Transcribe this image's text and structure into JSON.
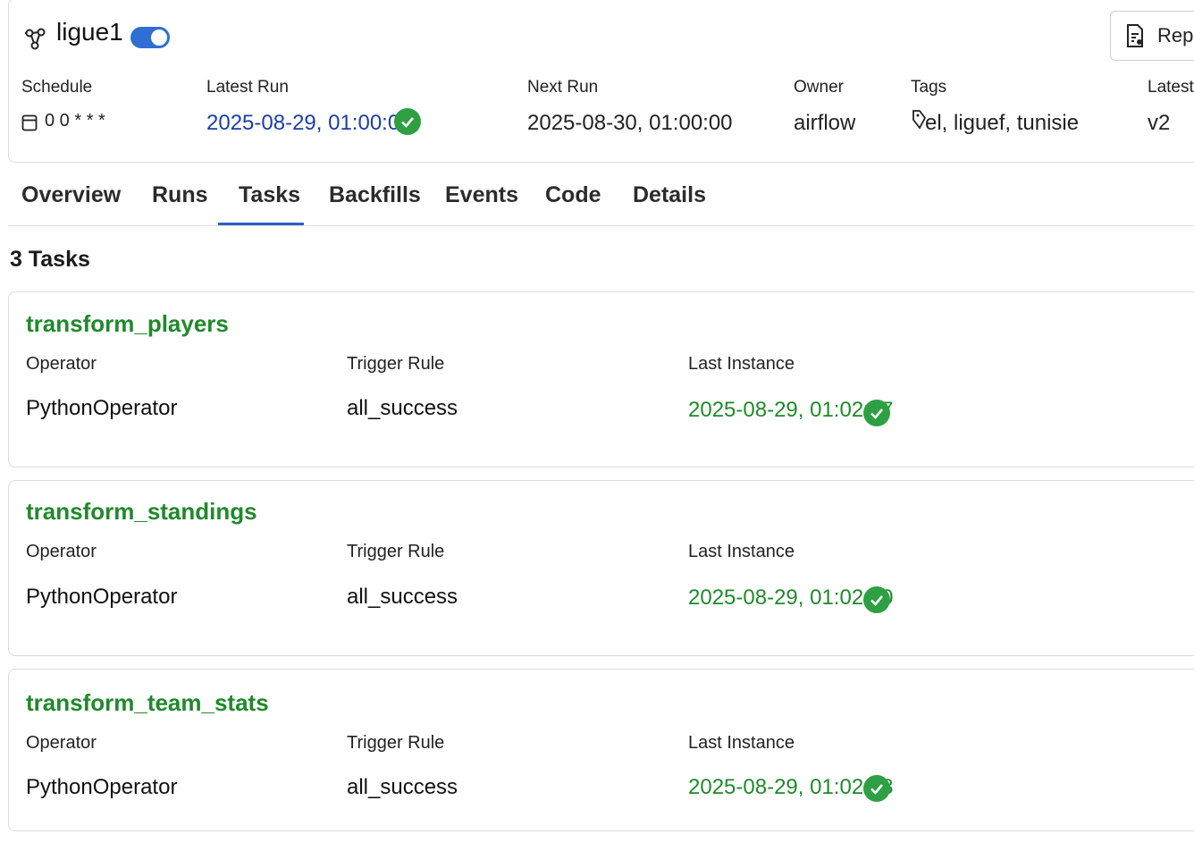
{
  "header": {
    "dag_id": "ligue1",
    "paused_toggle": "on",
    "reparse_label": "Repa",
    "schedule": {
      "label": "Schedule",
      "value": "0 0 * * *"
    },
    "latest_run": {
      "label": "Latest Run",
      "value": "2025-08-29, 01:00:00",
      "status": "success"
    },
    "next_run": {
      "label": "Next Run",
      "value": "2025-08-30, 01:00:00"
    },
    "owner": {
      "label": "Owner",
      "value": "airflow"
    },
    "tags": {
      "label": "Tags",
      "value": "el, liguef, tunisie"
    },
    "latest_version": {
      "label": "Latest",
      "value": "v2"
    }
  },
  "tabs": [
    {
      "label": "Overview"
    },
    {
      "label": "Runs"
    },
    {
      "label": "Tasks",
      "active": true
    },
    {
      "label": "Backfills"
    },
    {
      "label": "Events"
    },
    {
      "label": "Code"
    },
    {
      "label": "Details"
    }
  ],
  "task_count": "3 Tasks",
  "column_labels": {
    "operator": "Operator",
    "trigger_rule": "Trigger Rule",
    "last_instance": "Last Instance"
  },
  "tasks": [
    {
      "name": "transform_players",
      "operator": "PythonOperator",
      "trigger_rule": "all_success",
      "last_instance": "2025-08-29, 01:02:47",
      "status": "success"
    },
    {
      "name": "transform_standings",
      "operator": "PythonOperator",
      "trigger_rule": "all_success",
      "last_instance": "2025-08-29, 01:02:50",
      "status": "success"
    },
    {
      "name": "transform_team_stats",
      "operator": "PythonOperator",
      "trigger_rule": "all_success",
      "last_instance": "2025-08-29, 01:02:48",
      "status": "success"
    }
  ],
  "colors": {
    "success_green": "#2ea043",
    "link_blue": "#1a3fa8",
    "task_green": "#1f8a2a",
    "toggle_blue": "#2f6fd3"
  }
}
